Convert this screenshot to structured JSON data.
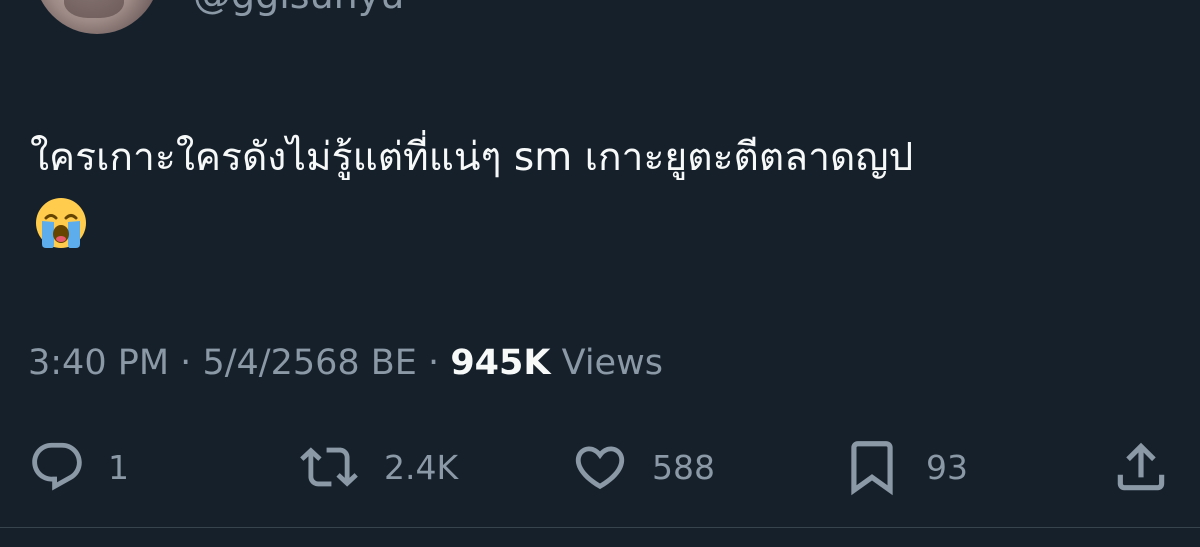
{
  "user": {
    "handle": "@ggisunyu"
  },
  "tweet": {
    "text": "ใครเกาะใครดังไม่รู้แต่ที่แน่ๆ sm เกาะยูตะตีตลาดญป",
    "emoji": "loudly-crying-face"
  },
  "meta": {
    "time": "3:40 PM",
    "sep1": "·",
    "date": "5/4/2568 BE",
    "sep2": "·",
    "views_count": "945K",
    "views_label": "Views"
  },
  "actions": {
    "reply_count": "1",
    "retweet_count": "2.4K",
    "like_count": "588",
    "bookmark_count": "93"
  },
  "colors": {
    "background": "#15202b",
    "text_primary": "#f7f9f9",
    "text_secondary": "#8b98a5",
    "divider": "#38444d"
  }
}
